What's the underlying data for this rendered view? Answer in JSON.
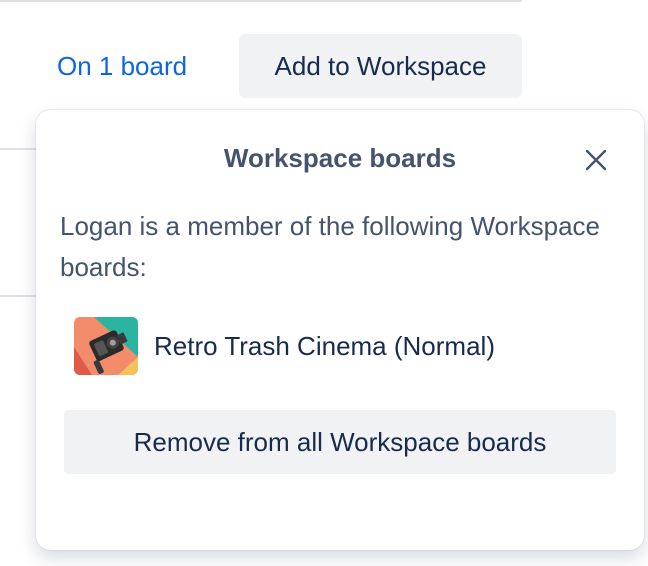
{
  "header": {
    "on_board_link": "On 1 board",
    "add_button_label": "Add to Workspace"
  },
  "popover": {
    "title": "Workspace boards",
    "description": "Logan is a member of the following Workspace boards:",
    "boards": [
      {
        "name": "Retro Trash Cinema (Normal)",
        "thumbnail_icon": "board-thumbnail-camera"
      }
    ],
    "remove_button_label": "Remove from all Workspace boards"
  },
  "colors": {
    "link": "#0c66e4",
    "button_bg": "#f1f2f4",
    "title_text": "#44546f",
    "body_text": "#172b4d"
  }
}
